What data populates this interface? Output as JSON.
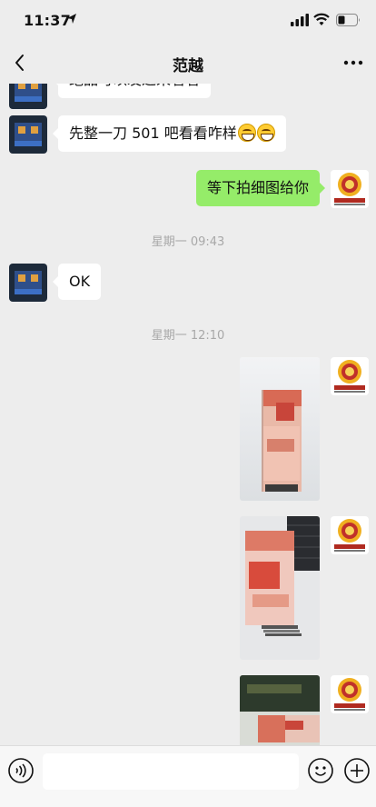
{
  "status_bar": {
    "time": "11:37",
    "icons": [
      "location-arrow-icon",
      "signal-icon",
      "wifi-icon",
      "battery-icon"
    ]
  },
  "nav": {
    "title": "范越",
    "back_icon": "chevron-left-icon",
    "more_icon": "more-dots-icon"
  },
  "messages": [
    {
      "side": "in",
      "type": "text",
      "text": "绝品可以发过来看看"
    },
    {
      "side": "in",
      "type": "text",
      "text": "先整一刀 501 吧看看咋样",
      "emojis": [
        "grin-emoji",
        "grin-emoji"
      ]
    },
    {
      "side": "out",
      "type": "text",
      "text": "等下拍细图给你"
    },
    {
      "type": "timestamp",
      "text": "星期一 09:43"
    },
    {
      "side": "in",
      "type": "text",
      "text": "OK"
    },
    {
      "type": "timestamp",
      "text": "星期一 12:10"
    },
    {
      "side": "out",
      "type": "image",
      "subject": "banknote-stack-photo"
    },
    {
      "side": "out",
      "type": "image",
      "subject": "banknote-stack-photo"
    },
    {
      "side": "out",
      "type": "image",
      "subject": "banknote-stack-photo"
    }
  ],
  "input_bar": {
    "placeholder": "",
    "voice_icon": "voice-icon",
    "emoji_icon": "smiley-icon",
    "plus_icon": "plus-circle-icon"
  },
  "colors": {
    "background": "#ededed",
    "incoming_bubble": "#ffffff",
    "outgoing_bubble": "#95ec69",
    "timestamp_text": "#a8a8a8"
  }
}
